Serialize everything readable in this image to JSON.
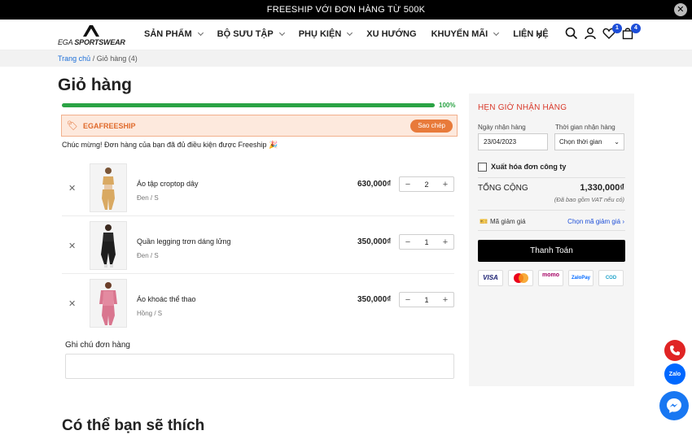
{
  "topbar": {
    "text": "FREESHIP VỚI ĐƠN HÀNG TỪ 500K"
  },
  "logo": {
    "text": "EGA SPORTSWEAR"
  },
  "nav": {
    "items": [
      {
        "label": "SẢN PHẨM",
        "dropdown": true
      },
      {
        "label": "BỘ SƯU TẬP",
        "dropdown": true
      },
      {
        "label": "PHỤ KIỆN",
        "dropdown": true
      },
      {
        "label": "XU HƯỚNG",
        "dropdown": false
      },
      {
        "label": "KHUYẾN MÃI",
        "dropdown": true
      },
      {
        "label": "LIÊN HỆ",
        "dropdown": false
      }
    ]
  },
  "header_badges": {
    "wishlist": "1",
    "cart": "4"
  },
  "breadcrumb": {
    "home": "Trang chủ",
    "current": " / Giỏ hàng (4)"
  },
  "page_title": "Giỏ hàng",
  "progress": {
    "percent_label": "100%",
    "value": 100
  },
  "coupon": {
    "code": "EGAFREESHIP",
    "copy_label": "Sao chép"
  },
  "congrats": "Chúc mừng! Đơn hàng của bạn đã đủ điều kiện được Freeship 🎉",
  "cart_items": [
    {
      "name": "Áo tập croptop dây",
      "variant": "Đen / S",
      "price": "630,000₫",
      "qty": "2",
      "color": "#d9a962"
    },
    {
      "name": "Quần legging trơn dáng lửng",
      "variant": "Đen / S",
      "price": "350,000₫",
      "qty": "1",
      "color": "#1e1e1e"
    },
    {
      "name": "Áo khoác thể thao",
      "variant": "Hồng / S",
      "price": "350,000₫",
      "qty": "1",
      "color": "#d9768f"
    }
  ],
  "note": {
    "label": "Ghi chú đơn hàng",
    "placeholder": ""
  },
  "suggest_title": "Có thể bạn sẽ thích",
  "sidebar": {
    "title": "HẸN GIỜ NHẬN HÀNG",
    "date_label": "Ngày nhận hàng",
    "date_value": "23/04/2023",
    "time_label": "Thời gian nhận hàng",
    "time_value": "Chọn thời gian",
    "invoice_label": "Xuất hóa đơn công ty",
    "total_label": "TỔNG CỘNG",
    "total_value": "1,330,000₫",
    "vat_note": "(Đã bao gồm VAT nếu có)",
    "voucher_label": "Mã giảm giá",
    "voucher_link": "Chọn mã giảm giá",
    "pay_label": "Thanh Toán",
    "payment_methods": [
      "VISA",
      "mastercard",
      "momo",
      "ZaloPay",
      "COD",
      "bank"
    ]
  },
  "colors": {
    "accent": "#d93a2b",
    "progress": "#2aa344",
    "link": "#1d4ed8",
    "coupon_bg": "#fde9dd"
  }
}
